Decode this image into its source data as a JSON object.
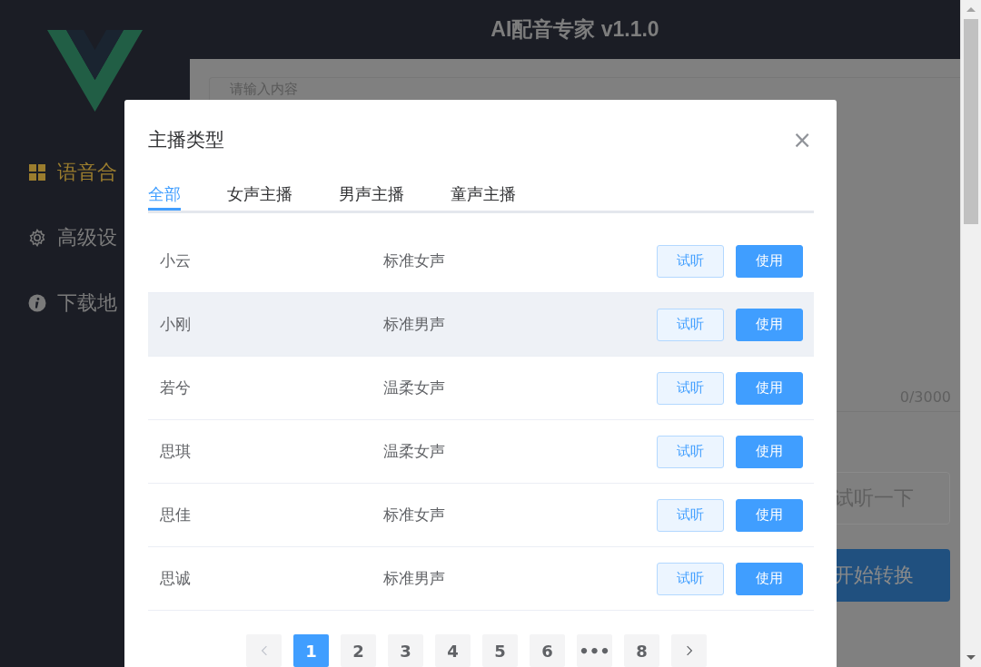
{
  "app": {
    "title": "AI配音专家 v1.1.0"
  },
  "sidebar": {
    "items": [
      {
        "label": "语音合",
        "selected": true
      },
      {
        "label": "高级设",
        "selected": false
      },
      {
        "label": "下载地",
        "selected": false
      }
    ]
  },
  "editor": {
    "placeholder": "请输入内容",
    "counter": "0/3000"
  },
  "actions": [
    {
      "label": "试听一下",
      "kind": "plain"
    },
    {
      "label": "开始转换",
      "kind": "primary"
    }
  ],
  "dialog": {
    "title": "主播类型",
    "close": "×",
    "tabs": [
      {
        "label": "全部",
        "selected": true
      },
      {
        "label": "女声主播",
        "selected": false
      },
      {
        "label": "男声主播",
        "selected": false
      },
      {
        "label": "童声主播",
        "selected": false
      }
    ],
    "rows": [
      {
        "name": "小云",
        "type": "标准女声",
        "preview": "试听",
        "use": "使用",
        "hovered": false
      },
      {
        "name": "小刚",
        "type": "标准男声",
        "preview": "试听",
        "use": "使用",
        "hovered": true
      },
      {
        "name": "若兮",
        "type": "温柔女声",
        "preview": "试听",
        "use": "使用",
        "hovered": false
      },
      {
        "name": "思琪",
        "type": "温柔女声",
        "preview": "试听",
        "use": "使用",
        "hovered": false
      },
      {
        "name": "思佳",
        "type": "标准女声",
        "preview": "试听",
        "use": "使用",
        "hovered": false
      },
      {
        "name": "思诚",
        "type": "标准男声",
        "preview": "试听",
        "use": "使用",
        "hovered": false
      }
    ],
    "pagination": {
      "prev_disabled": true,
      "next_disabled": false,
      "pages": [
        {
          "label": "1",
          "selected": true
        },
        {
          "label": "2",
          "selected": false
        },
        {
          "label": "3",
          "selected": false
        },
        {
          "label": "4",
          "selected": false
        },
        {
          "label": "5",
          "selected": false
        },
        {
          "label": "6",
          "selected": false
        },
        {
          "label": "•••",
          "selected": false
        },
        {
          "label": "8",
          "selected": false
        }
      ]
    }
  }
}
